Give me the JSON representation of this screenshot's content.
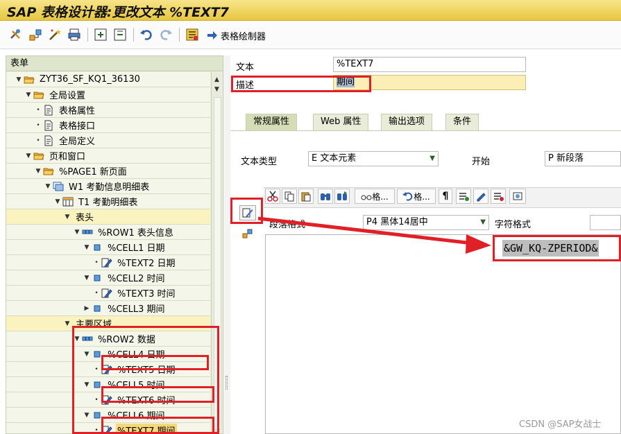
{
  "window": {
    "title": "SAP 表格设计器:更改文本 %TEXT7"
  },
  "toolbar": {
    "icons": [
      "tools-icon",
      "hierarchy-icon",
      "magic-wand-icon",
      "print-preview-icon",
      "expand-icon",
      "collapse-icon",
      "undo-icon",
      "redo-icon",
      "field-list-icon"
    ],
    "form_painter_label": "表格绘制器"
  },
  "tree": {
    "header": "表单",
    "rows": [
      {
        "label": "ZYT36_SF_KQ1_36130",
        "icon": "folder-open-icon",
        "twisty": "▼"
      },
      {
        "label": "全局设置",
        "icon": "folder-open-icon",
        "twisty": "▼"
      },
      {
        "label": "表格属性",
        "icon": "document-icon",
        "twisty": "•"
      },
      {
        "label": "表格接口",
        "icon": "document-icon",
        "twisty": "•"
      },
      {
        "label": "全局定义",
        "icon": "document-icon",
        "twisty": "•"
      },
      {
        "label": "页和窗口",
        "icon": "folder-open-icon",
        "twisty": "▼"
      },
      {
        "label": "%PAGE1 新页面",
        "icon": "folder-open-icon",
        "twisty": "▼"
      },
      {
        "label": "W1 考勤信息明细表",
        "icon": "window-icon",
        "twisty": "▼"
      },
      {
        "label": "T1 考勤明细表",
        "icon": "table-icon",
        "twisty": "▼"
      },
      {
        "label": "表头",
        "icon": "",
        "twisty": "▼"
      },
      {
        "label": "%ROW1 表头信息",
        "icon": "row-icon",
        "twisty": "▼"
      },
      {
        "label": "%CELL1 日期",
        "icon": "cell-icon",
        "twisty": "▼"
      },
      {
        "label": "%TEXT2 日期",
        "icon": "text-edit-icon",
        "twisty": "•"
      },
      {
        "label": "%CELL2 时间",
        "icon": "cell-icon",
        "twisty": "▼"
      },
      {
        "label": "%TEXT3 时间",
        "icon": "text-edit-icon",
        "twisty": "•"
      },
      {
        "label": "%CELL3 期间",
        "icon": "cell-icon",
        "twisty": "▶"
      },
      {
        "label": "主要区域",
        "icon": "",
        "twisty": "▼"
      },
      {
        "label": "%ROW2 数据",
        "icon": "row-icon",
        "twisty": "▼"
      },
      {
        "label": "%CELL4 日期",
        "icon": "cell-icon",
        "twisty": "▼"
      },
      {
        "label": "%TEXT5 日期",
        "icon": "text-edit-icon",
        "twisty": "•"
      },
      {
        "label": "%CELL5 时间",
        "icon": "cell-icon",
        "twisty": "▼"
      },
      {
        "label": "%TEXT6 时间",
        "icon": "text-edit-icon",
        "twisty": "•"
      },
      {
        "label": "%CELL6 期间",
        "icon": "cell-icon",
        "twisty": "▼"
      },
      {
        "label": "%TEXT7 期间",
        "icon": "text-edit-icon",
        "twisty": "•"
      }
    ]
  },
  "form": {
    "text_label": "文本",
    "text_value": "%TEXT7",
    "desc_label": "描述",
    "desc_value": "期间"
  },
  "tabs": [
    "常规属性",
    "Web 属性",
    "输出选项",
    "条件"
  ],
  "general": {
    "text_type_label": "文本类型",
    "text_type_value": "E 文本元素",
    "start_label": "开始",
    "start_value": "P 新段落",
    "para_format_label": "段落格式",
    "para_format_value": "P4 黑体14居中",
    "char_format_label": "字符格式",
    "char_format_value": ""
  },
  "editor_toolbar": {
    "field_btn_label": "格...",
    "undo_btn_label": "格...",
    "paragraph_mark": "¶"
  },
  "editor": {
    "content": "&GW_KQ-ZPERIOD&"
  },
  "watermark": "CSDN @SAP女战士",
  "colors": {
    "title_bg": "#e7c640",
    "tree_bg": "#f4f6ea",
    "annotation_red": "#e01f26",
    "required_field": "#fbefb6"
  }
}
